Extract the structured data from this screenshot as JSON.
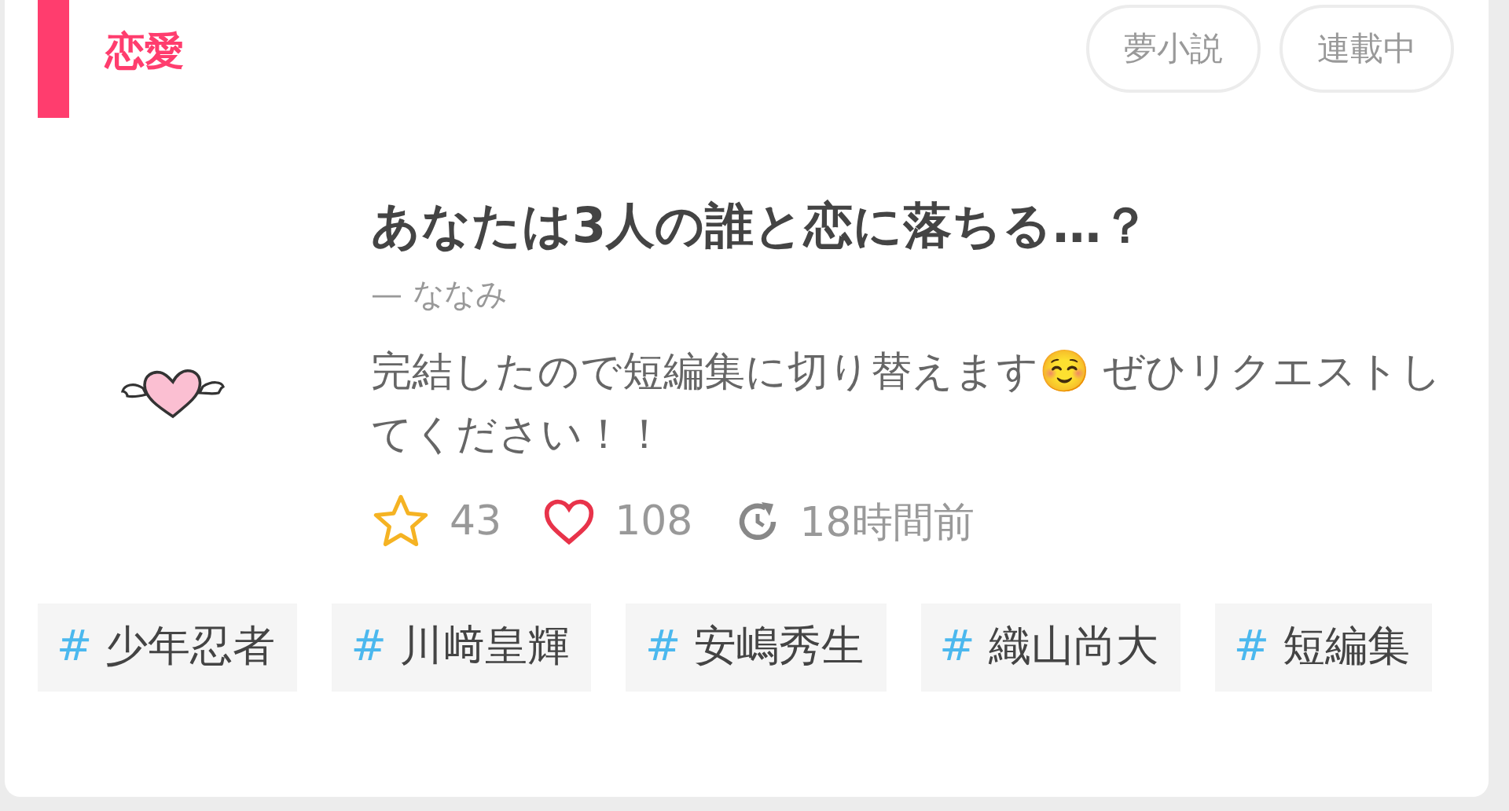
{
  "category": "恋愛",
  "badges": [
    "夢小説",
    "連載中"
  ],
  "title": "あなたは3人の誰と恋に落ちる…？",
  "author": "— ななみ",
  "description": "完結したので短編集に切り替えます☺️ ぜひリクエストしてください！！",
  "stats": [
    {
      "kind": "stars",
      "value": "43"
    },
    {
      "kind": "likes",
      "value": "108"
    },
    {
      "kind": "updated",
      "value": "18時間前"
    }
  ],
  "tags": [
    {
      "mark": "#",
      "label": "少年忍者"
    },
    {
      "mark": "#",
      "label": "川﨑皇輝"
    },
    {
      "mark": "#",
      "label": "安嶋秀生"
    },
    {
      "mark": "#",
      "label": "織山尚大"
    },
    {
      "mark": "#",
      "label": "短編集"
    }
  ]
}
